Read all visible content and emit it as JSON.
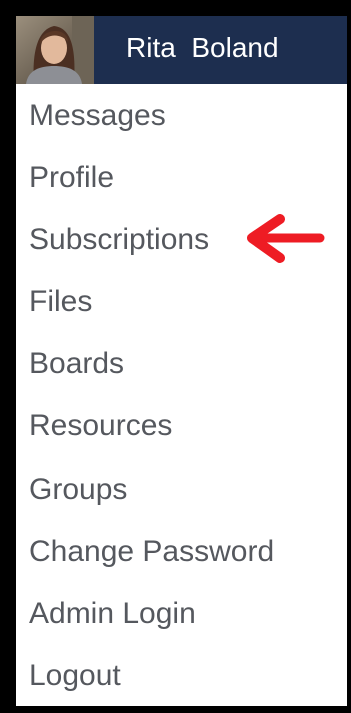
{
  "header": {
    "user_name": "Rita  Boland",
    "avatar_icon": "user-avatar-photo",
    "background_color": "#1d2e4f"
  },
  "menu": {
    "items": [
      {
        "label": "Messages"
      },
      {
        "label": "Profile"
      },
      {
        "label": "Subscriptions"
      },
      {
        "label": "Files"
      },
      {
        "label": "Boards"
      },
      {
        "label": "Resources"
      },
      {
        "label": "Groups"
      },
      {
        "label": "Change Password"
      },
      {
        "label": "Admin Login"
      },
      {
        "label": "Logout"
      }
    ],
    "text_color": "#55585e"
  },
  "annotation": {
    "icon": "red-arrow-icon",
    "color": "#ee1c24",
    "points_to": "Subscriptions"
  }
}
